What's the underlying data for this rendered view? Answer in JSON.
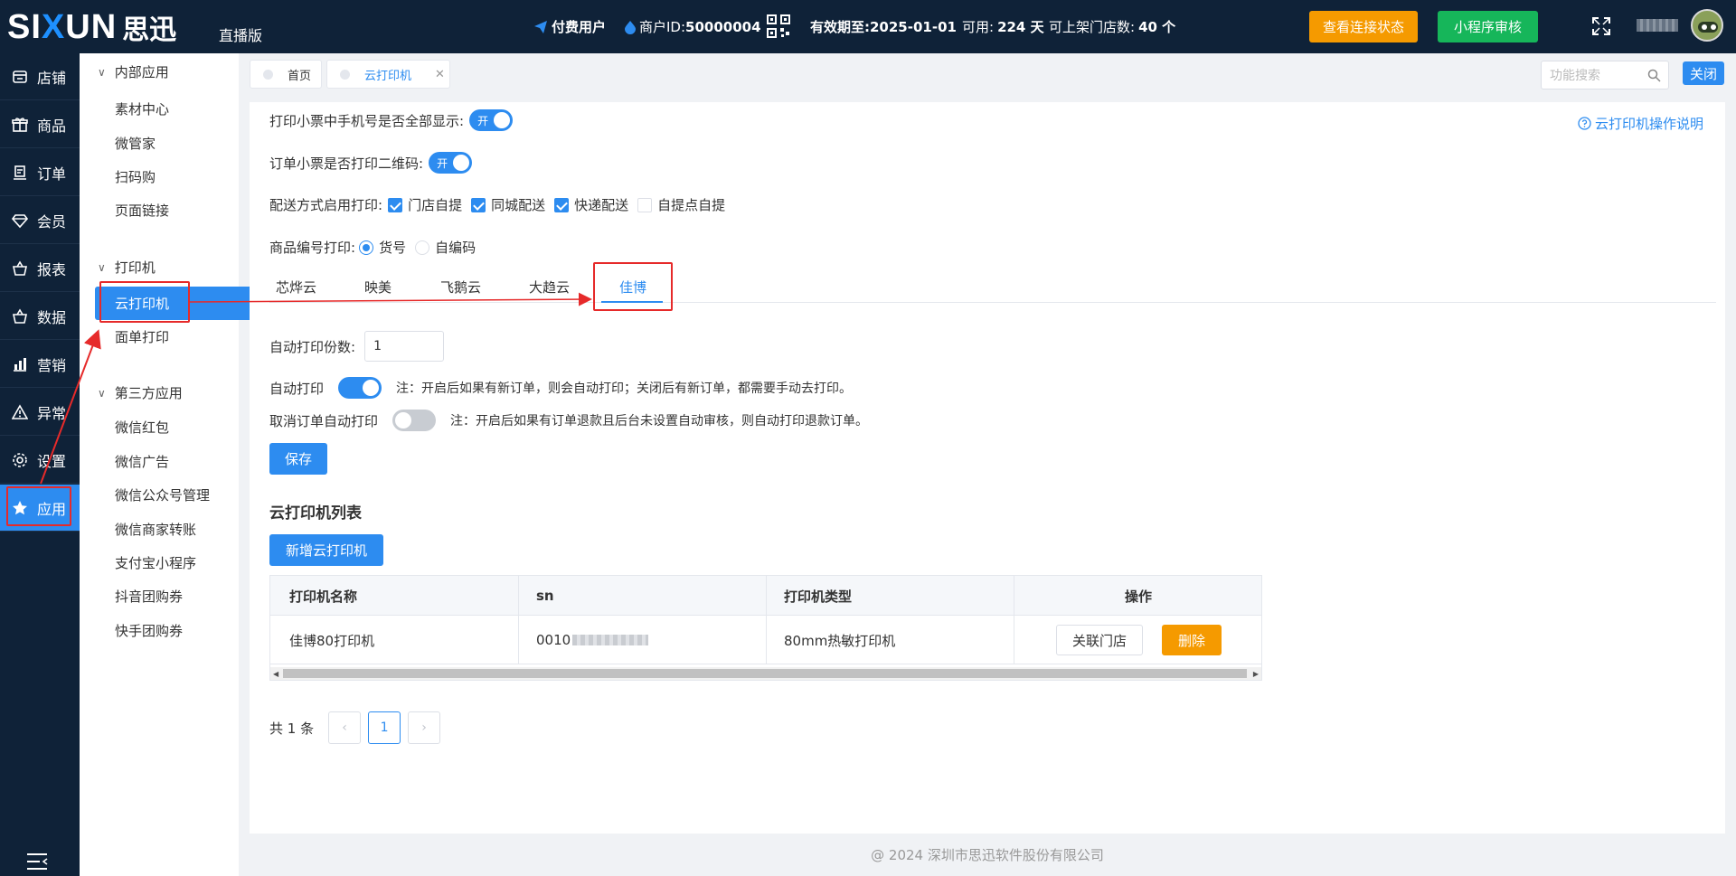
{
  "header": {
    "logo_latin": "SIXUN",
    "logo_cn": "思迅",
    "edition": "直播版",
    "paid_user": "付费用户",
    "merchant_label": "商户ID:",
    "merchant_id": "50000004",
    "expiry_label": "有效期至:",
    "expiry_date": "2025-01-01",
    "available_label": "可用:",
    "available_days": "224 天",
    "stores_label": "可上架门店数:",
    "stores_count": "40 个",
    "check_status_btn": "查看连接状态",
    "miniprogram_btn": "小程序审核",
    "colors": {
      "bg": "#0f2238",
      "orange": "#f59a00",
      "green": "#16b65a",
      "accent": "#2d8cf0"
    }
  },
  "left_nav": {
    "items": [
      {
        "label": "店铺",
        "icon": "store-icon"
      },
      {
        "label": "商品",
        "icon": "gift-icon"
      },
      {
        "label": "订单",
        "icon": "order-icon"
      },
      {
        "label": "会员",
        "icon": "diamond-icon"
      },
      {
        "label": "报表",
        "icon": "basket-icon"
      },
      {
        "label": "数据",
        "icon": "basket-icon"
      },
      {
        "label": "营销",
        "icon": "bar-chart-icon"
      },
      {
        "label": "异常",
        "icon": "warning-icon"
      },
      {
        "label": "设置",
        "icon": "gear-icon"
      },
      {
        "label": "应用",
        "icon": "star-icon",
        "active": true
      }
    ]
  },
  "sub_nav": {
    "groups": [
      {
        "title": "内部应用",
        "items": [
          "素材中心",
          "微管家",
          "扫码购",
          "页面链接"
        ]
      },
      {
        "title": "打印机",
        "items": [
          "云打印机",
          "面单打印"
        ],
        "active": "云打印机"
      },
      {
        "title": "第三方应用",
        "items": [
          "微信红包",
          "微信广告",
          "微信公众号管理",
          "微信商家转账",
          "支付宝小程序",
          "抖音团购券",
          "快手团购券"
        ]
      }
    ]
  },
  "tabs": [
    {
      "label": "首页"
    },
    {
      "label": "云打印机",
      "active": true
    }
  ],
  "search": {
    "placeholder": "功能搜索"
  },
  "close_btn": "关闭",
  "help_link": "云打印机操作说明",
  "settings": {
    "phone_full_label": "打印小票中手机号是否全部显示:",
    "phone_full_switch": "开",
    "qr_label": "订单小票是否打印二维码:",
    "qr_switch": "开",
    "delivery_label": "配送方式启用打印:",
    "delivery_options": [
      {
        "label": "门店自提",
        "checked": true
      },
      {
        "label": "同城配送",
        "checked": true
      },
      {
        "label": "快递配送",
        "checked": true
      },
      {
        "label": "自提点自提",
        "checked": false
      }
    ],
    "sku_label": "商品编号打印:",
    "sku_options": [
      {
        "label": "货号",
        "selected": true
      },
      {
        "label": "自编码",
        "selected": false
      }
    ]
  },
  "printer_tabs": [
    "芯烨云",
    "映美",
    "飞鹅云",
    "大趋云",
    "佳博"
  ],
  "printer_tab_active": "佳博",
  "auto_print": {
    "copies_label": "自动打印份数:",
    "copies_value": "1",
    "auto_label": "自动打印",
    "auto_on": true,
    "auto_note": "注：开启后如果有新订单，则会自动打印；关闭后有新订单，都需要手动去打印。",
    "cancel_label": "取消订单自动打印",
    "cancel_on": false,
    "cancel_note": "注：开启后如果有订单退款且后台未设置自动审核，则自动打印退款订单。",
    "save_btn": "保存"
  },
  "printer_list": {
    "title": "云打印机列表",
    "add_btn": "新增云打印机",
    "columns": [
      "打印机名称",
      "sn",
      "打印机类型",
      "操作"
    ],
    "rows": [
      {
        "name": "佳博80打印机",
        "sn_prefix": "0010",
        "type": "80mm热敏打印机",
        "link_btn": "关联门店",
        "delete_btn": "删除"
      }
    ]
  },
  "pagination": {
    "total": "共 1 条",
    "current": "1",
    "prev": "‹",
    "next": "›"
  },
  "footer": "@ 2024 深圳市思迅软件股份有限公司"
}
